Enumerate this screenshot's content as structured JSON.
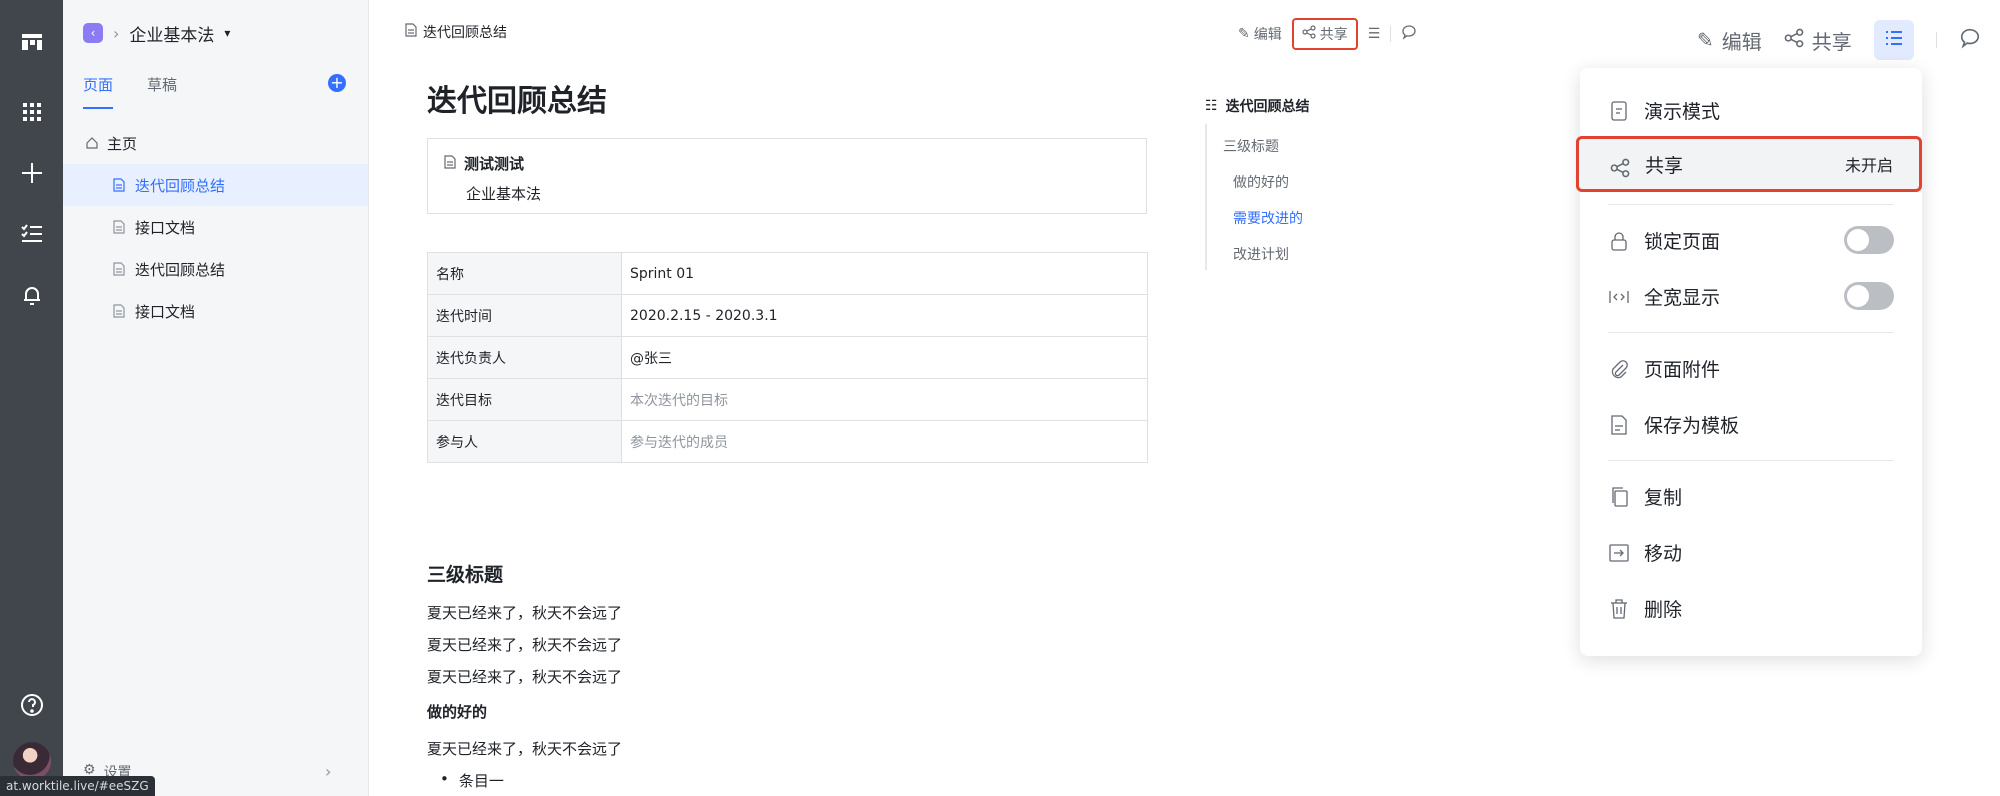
{
  "sidebar": {
    "space_name": "企业基本法",
    "tabs": [
      {
        "label": "页面"
      },
      {
        "label": "草稿"
      }
    ],
    "add_label": "+",
    "home_label": "主页",
    "items": [
      {
        "label": "迭代回顾总结"
      },
      {
        "label": "接口文档"
      },
      {
        "label": "迭代回顾总结"
      },
      {
        "label": "接口文档"
      }
    ],
    "settings_label": "设置"
  },
  "status_url": "at.worktile.live/#eeSZG",
  "doc": {
    "breadcrumb": "迭代回顾总结",
    "toolbar": {
      "edit": "编辑",
      "share": "共享"
    },
    "title": "迭代回顾总结",
    "quote": {
      "title": "测试测试",
      "subtitle": "企业基本法"
    },
    "table": [
      {
        "key": "名称",
        "value": "Sprint 01"
      },
      {
        "key": "迭代时间",
        "value": "2020.2.15 - 2020.3.1"
      },
      {
        "key": "迭代负责人",
        "value": "@张三"
      },
      {
        "key": "迭代目标",
        "value": "本次迭代的目标"
      },
      {
        "key": "参与人",
        "value": "参与迭代的成员"
      }
    ],
    "h3": "三级标题",
    "paragraphs": [
      "夏天已经来了，秋天不会远了",
      "夏天已经来了，秋天不会远了",
      "夏天已经来了，秋天不会远了"
    ],
    "h4": "做的好的",
    "paragraph4": "夏天已经来了，秋天不会远了",
    "bullet": "条目一"
  },
  "toc": {
    "title": "迭代回顾总结",
    "items": [
      {
        "label": "三级标题"
      },
      {
        "label": "做的好的"
      },
      {
        "label": "需要改进的"
      },
      {
        "label": "改进计划"
      }
    ]
  },
  "header": {
    "edit": "编辑",
    "share": "共享"
  },
  "menu": {
    "present": "演示模式",
    "share": "共享",
    "share_status": "未开启",
    "lock": "锁定页面",
    "fullwidth": "全宽显示",
    "attachments": "页面附件",
    "save_template": "保存为模板",
    "copy": "复制",
    "move": "移动",
    "delete": "删除"
  },
  "colors": {
    "accent": "#3370ff",
    "highlight": "#e0432f",
    "rail": "#41464d"
  }
}
